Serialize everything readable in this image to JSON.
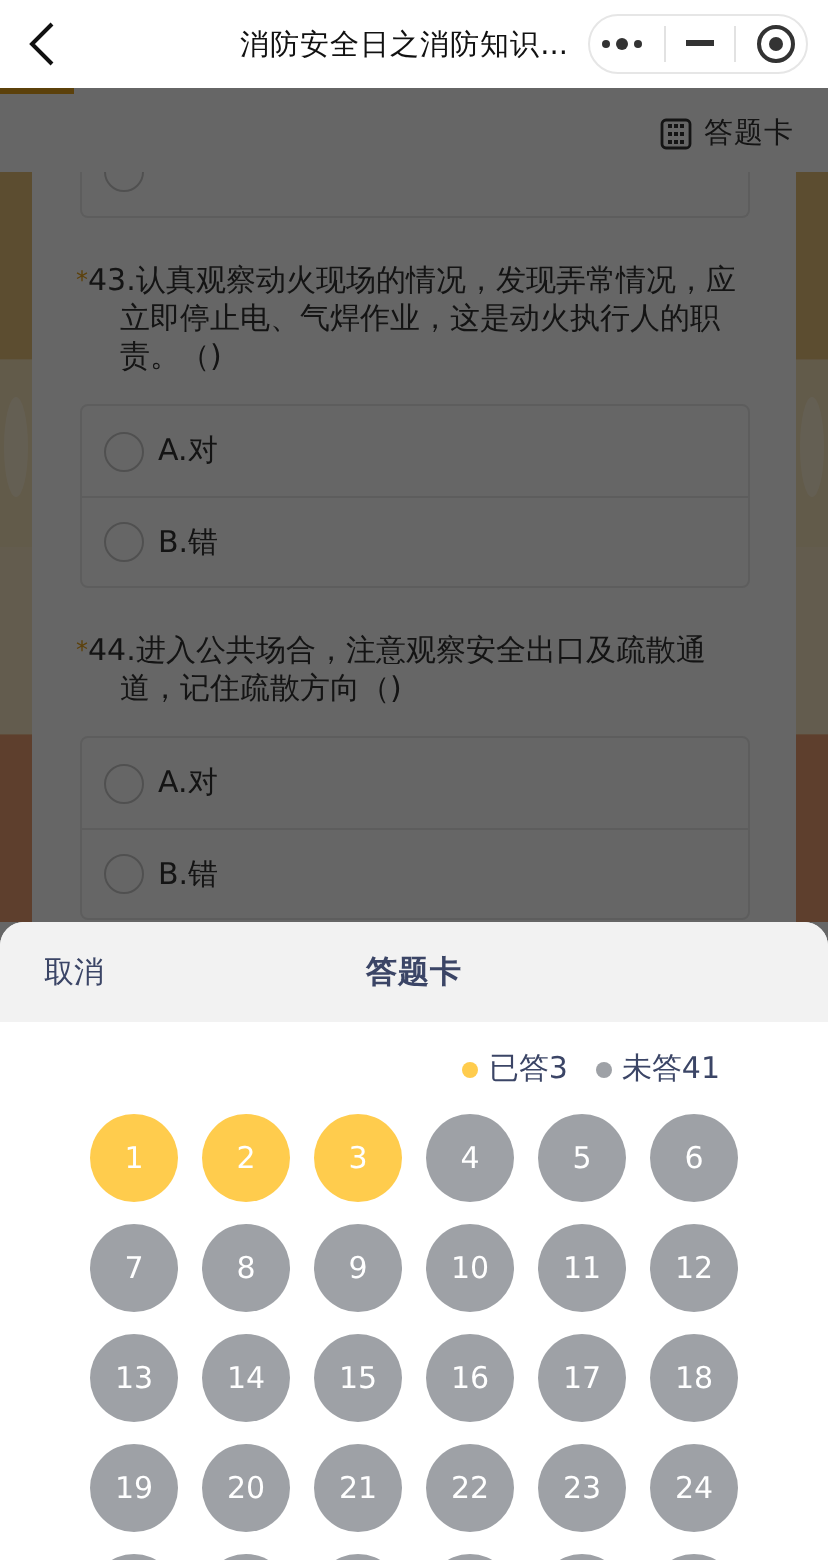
{
  "header": {
    "title": "消防安全日之消防知识..."
  },
  "progress": {
    "level": 0.09
  },
  "toolbar": {
    "answer_card_label": "答题卡"
  },
  "partial_option": {
    "selected": false
  },
  "questions": [
    {
      "required_mark": "*",
      "text": "43.认真观察动火现场的情况，发现弄常情况，应立即停止电、气焊作业，这是动火执行人的职责。（)",
      "options": [
        {
          "label": "A.对",
          "selected": false
        },
        {
          "label": "B.错",
          "selected": false
        }
      ]
    },
    {
      "required_mark": "*",
      "text": "44.进入公共场合，注意观察安全出口及疏散通道，记住疏散方向（)",
      "options": [
        {
          "label": "A.对",
          "selected": false
        },
        {
          "label": "B.错",
          "selected": false
        }
      ]
    }
  ],
  "sheet": {
    "cancel": "取消",
    "title": "答题卡",
    "legend": [
      {
        "label": "已答3",
        "color": "#ffcc4d"
      },
      {
        "label": "未答41",
        "color": "#9ea1a6"
      }
    ],
    "items": [
      {
        "label": "1",
        "answered": true
      },
      {
        "label": "2",
        "answered": true
      },
      {
        "label": "3",
        "answered": true
      },
      {
        "label": "4",
        "answered": false
      },
      {
        "label": "5",
        "answered": false
      },
      {
        "label": "6",
        "answered": false
      },
      {
        "label": "7",
        "answered": false
      },
      {
        "label": "8",
        "answered": false
      },
      {
        "label": "9",
        "answered": false
      },
      {
        "label": "10",
        "answered": false
      },
      {
        "label": "11",
        "answered": false
      },
      {
        "label": "12",
        "answered": false
      },
      {
        "label": "13",
        "answered": false
      },
      {
        "label": "14",
        "answered": false
      },
      {
        "label": "15",
        "answered": false
      },
      {
        "label": "16",
        "answered": false
      },
      {
        "label": "17",
        "answered": false
      },
      {
        "label": "18",
        "answered": false
      },
      {
        "label": "19",
        "answered": false
      },
      {
        "label": "20",
        "answered": false
      },
      {
        "label": "21",
        "answered": false
      },
      {
        "label": "22",
        "answered": false
      },
      {
        "label": "23",
        "answered": false
      },
      {
        "label": "24",
        "answered": false
      },
      {
        "answered": false
      },
      {
        "answered": false
      },
      {
        "answered": false
      },
      {
        "answered": false
      },
      {
        "answered": false
      },
      {
        "answered": false
      }
    ]
  }
}
